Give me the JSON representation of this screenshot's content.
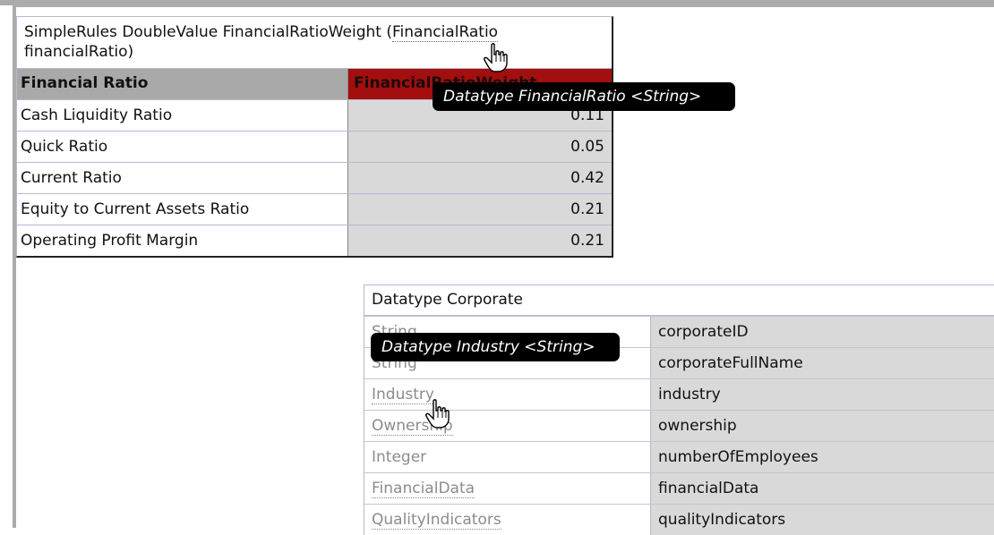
{
  "rules_table": {
    "title_prefix": "SimpleRules DoubleValue FinancialRatioWeight (",
    "title_link": "FinancialRatio",
    "title_suffix": "financialRatio)",
    "header_col1": "Financial Ratio",
    "header_col2": "FinancialRatioWeight",
    "rows": [
      {
        "ratio": "Cash Liquidity Ratio",
        "weight": "0.11"
      },
      {
        "ratio": "Quick Ratio",
        "weight": "0.05"
      },
      {
        "ratio": "Current Ratio",
        "weight": "0.42"
      },
      {
        "ratio": "Equity to Current Assets Ratio",
        "weight": "0.21"
      },
      {
        "ratio": "Operating Profit Margin",
        "weight": "0.21"
      }
    ]
  },
  "datatype_table": {
    "title": "Datatype Corporate",
    "rows": [
      {
        "type": "String",
        "field": "corporateID"
      },
      {
        "type": "String",
        "field": "corporateFullName"
      },
      {
        "type": "Industry",
        "field": "industry"
      },
      {
        "type": "Ownership",
        "field": "ownership"
      },
      {
        "type": "Integer",
        "field": "numberOfEmployees"
      },
      {
        "type": "FinancialData",
        "field": "financialData"
      },
      {
        "type": "QualityIndicators",
        "field": "qualityIndicators"
      }
    ]
  },
  "tooltips": {
    "financial_ratio": "Datatype FinancialRatio <String>",
    "industry": "Datatype Industry <String>"
  },
  "colors": {
    "header_gray": "#a9a9a9",
    "header_red": "#a30e0e",
    "cell_gray": "#d9d9d9"
  }
}
